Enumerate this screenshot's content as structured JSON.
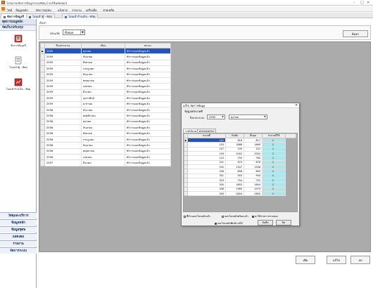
{
  "window": {
    "title": "โปรแกรมจัดการข้อมูลระบบพัสดุ (เวอร์ชั่นทดสอบ)",
    "controls": [
      "–",
      "□",
      "✕"
    ]
  },
  "menu": {
    "items": [
      "ไฟล์",
      "ข้อมูลหลัก",
      "จัดการสุรุทน",
      "แจ้งจ่าย",
      "รายงาน",
      "เครื่องมือ",
      "ช่วยเหลือ"
    ]
  },
  "doc_tabs": [
    "จัดการข้อมูลรี",
    "โอนเข้าตู้ - พัสดุ",
    "โอนเข้าร้านเงิน - พัสดุ"
  ],
  "left_nav": {
    "header": "ทุดการเมนูหลัก",
    "group": "จัดเก็บ/ปรับปรุง",
    "entries": [
      "จัดการข้อมูลรี",
      "โอนเข้าตู้ - พัสดุ",
      "โอนเข้าร้านเงิน - พัสดุ"
    ],
    "bottom": [
      "วัสดุและบริการ",
      "ข้อมูลหลัก",
      "ข้อมูลทุดพ",
      "แสดงผล",
      "รายงาน",
      "จัดการระบบ"
    ]
  },
  "main": {
    "breadcrumb": "ค้นหา",
    "filter_label": "ประเภท",
    "filter_value": "ทั้งหมด",
    "search_button": "ค้นหา",
    "grid": {
      "columns": [
        "ปีงบประมาณ",
        "เดือน",
        "สถานะ"
      ],
      "rows": [
        [
          "2560",
          "ตุลาคม",
          "ทำการออกข้อมูลแล้ว"
        ],
        [
          "2559",
          "กันยายน",
          "ทำการออกข้อมูลแล้ว"
        ],
        [
          "2559",
          "สิงหาคม",
          "ทำการออกข้อมูลแล้ว"
        ],
        [
          "2559",
          "กรกฎาคม",
          "ทำการออกข้อมูลแล้ว"
        ],
        [
          "2559",
          "มิถุนายน",
          "ทำการออกข้อมูลแล้ว"
        ],
        [
          "2559",
          "พฤษภาคม",
          "ทำการออกข้อมูลแล้ว"
        ],
        [
          "2559",
          "เมษายน",
          "ทำการออกข้อมูลแล้ว"
        ],
        [
          "2559",
          "มีนาคม",
          "ทำการออกข้อมูลแล้ว"
        ],
        [
          "2559",
          "กุมภาพันธ์",
          "ทำการออกข้อมูลแล้ว"
        ],
        [
          "2559",
          "มกราคม",
          "ทำการออกข้อมูลแล้ว"
        ],
        [
          "2558",
          "ธันวาคม",
          "ทำการออกข้อมูลแล้ว"
        ],
        [
          "2558",
          "พฤศจิกายน",
          "ทำการออกข้อมูลแล้ว"
        ],
        [
          "2558",
          "ตุลาคม",
          "ทำการออกข้อมูลแล้ว"
        ],
        [
          "2558",
          "กันยายน",
          "ทำการออกข้อมูลแล้ว"
        ],
        [
          "2558",
          "สิงหาคม",
          "ทำการออกข้อมูลแล้ว"
        ],
        [
          "2558",
          "กรกฎาคม",
          "ทำการออกข้อมูลแล้ว"
        ],
        [
          "2558",
          "มิถุนายน",
          "ทำการออกข้อมูลแล้ว"
        ],
        [
          "2558",
          "พฤษภาคม",
          "ทำการออกข้อมูลแล้ว"
        ],
        [
          "2558",
          "เมษายน",
          "ทำการออกข้อมูลแล้ว"
        ],
        [
          "2557",
          "มีนาคม",
          "ทำการออกข้อมูลแล้ว"
        ]
      ]
    }
  },
  "dialog": {
    "title": "แก้ไข จัดการข้อมูล",
    "section": "ข้อมูลหลักงวดที่",
    "year_label": "ปีงบประมาณ",
    "year_value": "2562",
    "month_value": "ตุลาคม",
    "tabs": [
      "รายได้สาคา",
      "ค่าจ่ายบธรรม"
    ],
    "grid": {
      "columns": [
        "หน่วยที่",
        "เริ่มต้น",
        "สิ้นสุด",
        "จำนวนที่ใช้"
      ],
      "rows": [
        [
          "101",
          "816",
          "817",
          "1"
        ],
        [
          "103",
          "1868",
          "1869",
          "1"
        ],
        [
          "107",
          "100",
          "101",
          "1"
        ],
        [
          "109",
          "2002",
          "2003",
          "1"
        ],
        [
          "110",
          "759",
          "760",
          "1"
        ],
        [
          "201",
          "675",
          "676",
          "1"
        ],
        [
          "202",
          "1547",
          "1548",
          "1"
        ],
        [
          "206",
          "898",
          "899",
          "1"
        ],
        [
          "301",
          "943",
          "944",
          "1"
        ],
        [
          "303",
          "754",
          "755",
          "1"
        ],
        [
          "305",
          "1803",
          "1804",
          "1"
        ],
        [
          "306",
          "1969",
          "1970",
          "1"
        ],
        [
          "309",
          "2604",
          "2605",
          "1"
        ]
      ]
    },
    "checks": [
      {
        "label": "ที่บ้านออกโอนหลังแล้ว",
        "checked": false
      },
      {
        "label": "ออกโอนหลังพร้อมแล้ว",
        "checked": false
      },
      {
        "label": "ค่าใช้รายการตามของ",
        "checked": true
      },
      {
        "label": "ออกโอนหลังพิมพ์รายได้",
        "checked": true
      }
    ],
    "save_button": "บันทึก",
    "close_button": "ปิด"
  },
  "footer": {
    "buttons": [
      "เพิ่ม",
      "แก้ไข",
      "ลบ"
    ]
  },
  "colors": {
    "selection": "#1f54c9",
    "count_cell": "#aee6ea",
    "workspace": "#ababab"
  }
}
